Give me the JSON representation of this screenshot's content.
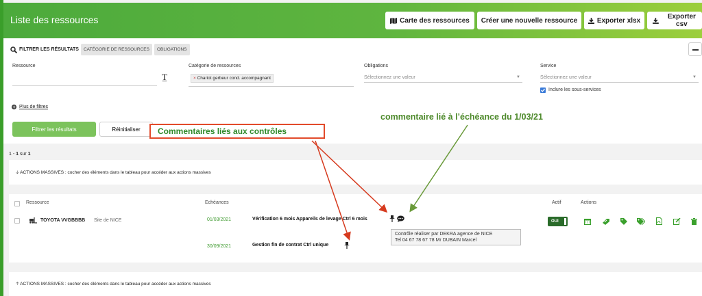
{
  "header": {
    "title": "Liste des ressources",
    "buttons": [
      {
        "label": "Carte des ressources",
        "icon": "map-icon"
      },
      {
        "label": "Créer une nouvelle ressource",
        "icon": ""
      },
      {
        "label": "Exporter xlsx",
        "icon": "download-icon"
      },
      {
        "label": "Exporter csv",
        "icon": "download-icon"
      }
    ]
  },
  "filters": {
    "heading": "FILTRER LES RÉSULTATS",
    "chips": [
      "CATÉGORIE DE RESSOURCES",
      "OBLIGATIONS"
    ],
    "fields": {
      "ressource_label": "Ressource",
      "categorie_label": "Catégorie de ressources",
      "categorie_tag_remove": "×",
      "categorie_tag": "Chariot gerbeur cond. accompagnant",
      "obligations_label": "Obligations",
      "obligations_placeholder": "Sélectionnez une valeur",
      "service_label": "Service",
      "service_placeholder": "Sélectionnez une valeur",
      "sous_services_label": "Inclure les sous-services"
    },
    "more_filters": "Plus de filtres",
    "submit_label": "Filtrer les résultats",
    "reset_label": "Réinitialiser"
  },
  "annotations": {
    "red_box": "Commentaires liés aux contrôles",
    "green_text": "commentaire lié à l’échéance du 1/03/21"
  },
  "results": {
    "count_prefix": "1 - ",
    "count_from": "1",
    "count_mid": " sur ",
    "count_total": "1",
    "mass_actions_top": "ACTIONS MASSIVES : cocher des éléments dans le tableau pour accéder aux actions massives",
    "mass_actions_bottom": "ACTIONS MASSIVES : cocher des éléments dans le tableau pour accéder aux actions massives"
  },
  "table": {
    "headers": {
      "ressource": "Ressource",
      "echeances": "Echéances",
      "actif": "Actif",
      "actions": "Actions"
    },
    "row": {
      "name": "TOYOTA VVGBBBB",
      "site": "Site de NICE",
      "actif": "OUI",
      "echeances": [
        {
          "date": "01/03/2021",
          "label": "Vérification 6 mois Appareils de levage Ctrl 6 mois"
        },
        {
          "date": "30/09/2021",
          "label": "Gestion fin de contrat Ctrl unique"
        }
      ],
      "actions": [
        "calendar-icon",
        "tag-pen-icon",
        "tag-icon",
        "tags-icon",
        "pdf-icon",
        "edit-icon",
        "trash-icon"
      ]
    }
  },
  "tooltip": {
    "line1": "Contrôle réaliser par DEKRA agence de NICE",
    "line2": "Tel 04 67 78 67 78  Mr DUBAIN Marcel"
  },
  "colors": {
    "brand_green": "#4caa3c",
    "annotation_red": "#e24a2a",
    "annotation_green": "#6a9a3a"
  }
}
